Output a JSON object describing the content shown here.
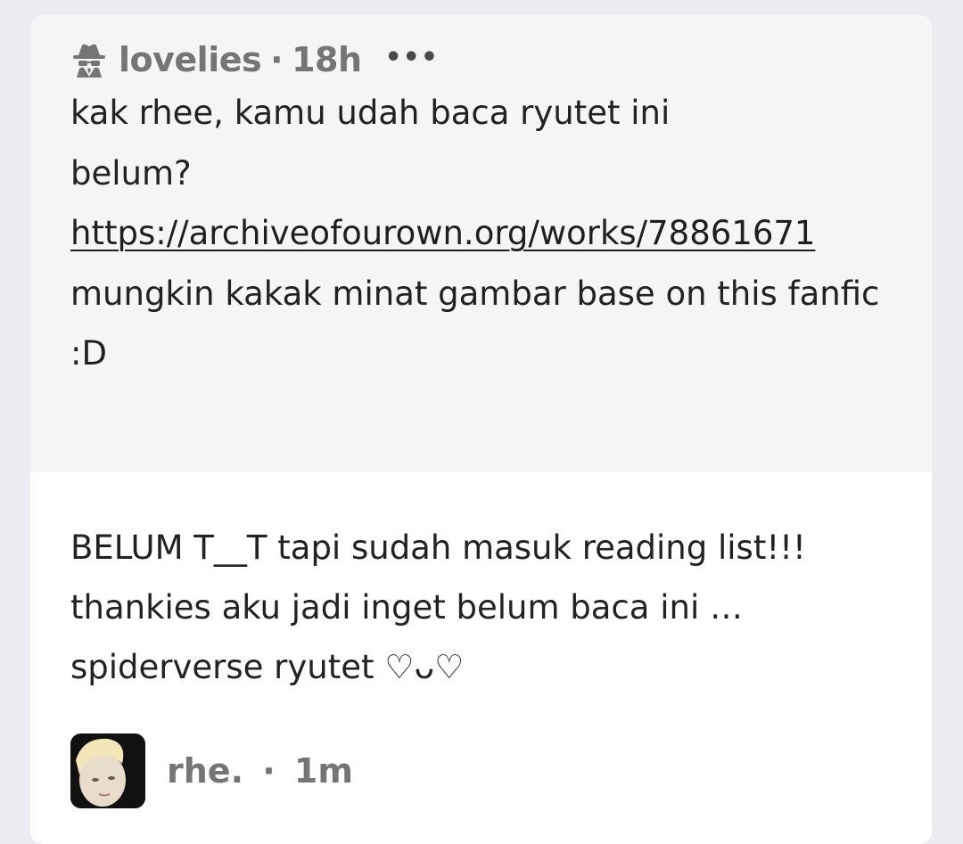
{
  "question": {
    "user": "lovelies",
    "separator": "·",
    "time": "18h",
    "more_icon": "more-dots-icon",
    "avatar_icon": "anonymous-spy-icon",
    "line1": "kak rhee, kamu udah baca ryutet ini belum?",
    "link": "https://archiveofourown.org/works/78861671",
    "line2": "mungkin kakak minat gambar base on this fanfic :D"
  },
  "answer": {
    "text": "BELUM T__T tapi sudah masuk reading list!!! thankies aku jadi inget belum baca ini … spiderverse ryutet ♡ᴗ♡"
  },
  "author": {
    "name": "rhe.",
    "separator": "·",
    "time": "1m"
  },
  "colors": {
    "page_bg": "#ecebf1",
    "question_bg": "#f5f5f5",
    "card_bg": "#ffffff",
    "meta_text": "#757575"
  }
}
